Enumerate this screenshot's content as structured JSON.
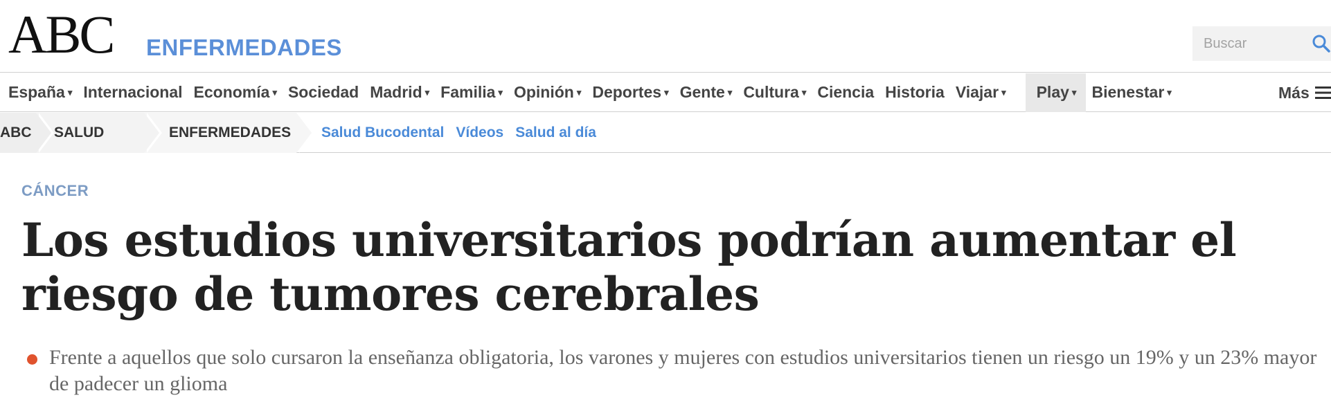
{
  "header": {
    "logo": "ABC",
    "section": "ENFERMEDADES",
    "search_placeholder": "Buscar"
  },
  "nav": {
    "items": [
      {
        "label": "España",
        "dropdown": true
      },
      {
        "label": "Internacional",
        "dropdown": false
      },
      {
        "label": "Economía",
        "dropdown": true
      },
      {
        "label": "Sociedad",
        "dropdown": false
      },
      {
        "label": "Madrid",
        "dropdown": true
      },
      {
        "label": "Familia",
        "dropdown": true
      },
      {
        "label": "Opinión",
        "dropdown": true
      },
      {
        "label": "Deportes",
        "dropdown": true
      },
      {
        "label": "Gente",
        "dropdown": true
      },
      {
        "label": "Cultura",
        "dropdown": true
      },
      {
        "label": "Ciencia",
        "dropdown": false
      },
      {
        "label": "Historia",
        "dropdown": false
      },
      {
        "label": "Viajar",
        "dropdown": true
      },
      {
        "label": "Play",
        "dropdown": true
      },
      {
        "label": "Bienestar",
        "dropdown": true
      }
    ],
    "more_label": "Más",
    "caret": "▾"
  },
  "breadcrumb": {
    "items": [
      "ABC",
      "SALUD",
      "ENFERMEDADES"
    ],
    "links": [
      "Salud Bucodental",
      "Vídeos",
      "Salud al día"
    ]
  },
  "article": {
    "category": "CÁNCER",
    "headline": "Los estudios universitarios podrían aumentar el riesgo de tumores cerebrales",
    "summary": "Frente a aquellos que solo cursaron la enseñanza obligatoria, los varones y mujeres con estudios universitarios tienen un riesgo un 19% y un 23% mayor de padecer un glioma"
  },
  "colors": {
    "accent_blue": "#5b8fd8",
    "link_blue": "#4a8ad8",
    "category_blue": "#7d9cc4",
    "bullet_red": "#e0532e"
  }
}
